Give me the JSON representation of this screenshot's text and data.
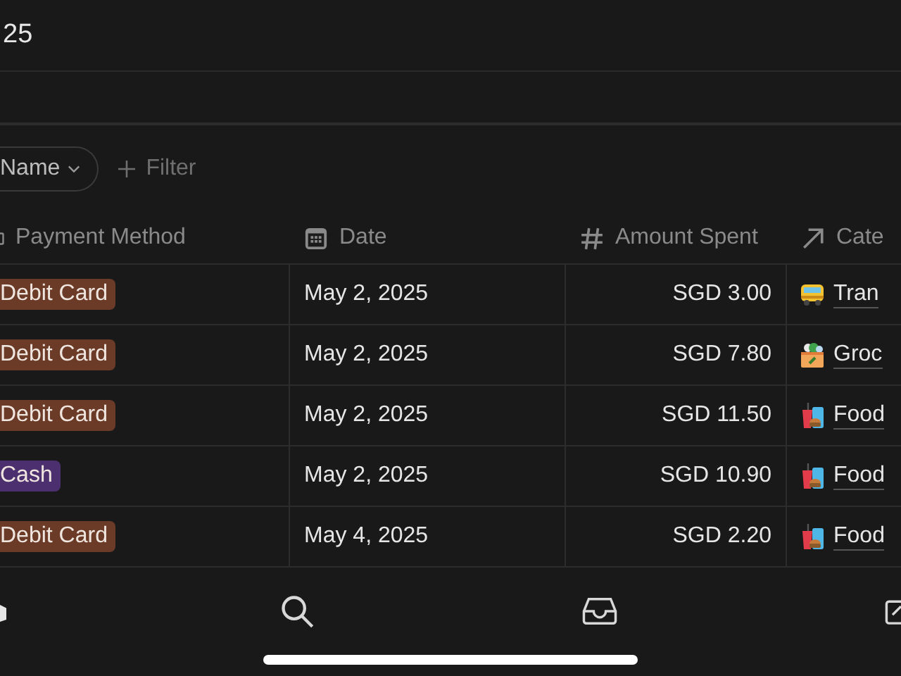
{
  "title": "25",
  "filter_bar": {
    "sort_chip": "Name",
    "filter_button": "Filter"
  },
  "table": {
    "columns": [
      "Payment Method",
      "Date",
      "Amount Spent",
      "Cate"
    ],
    "rows": [
      {
        "payment": "Debit Card",
        "color": "#6b3b27",
        "date": "May 2, 2025",
        "amount": "SGD 3.00",
        "category": "Tran",
        "kind": "bus"
      },
      {
        "payment": "Debit Card",
        "color": "#6b3b27",
        "date": "May 2, 2025",
        "amount": "SGD 7.80",
        "category": "Groc",
        "kind": "groceries"
      },
      {
        "payment": "Debit Card",
        "color": "#6b3b27",
        "date": "May 2, 2025",
        "amount": "SGD 11.50",
        "category": "Food",
        "kind": "food"
      },
      {
        "payment": "Cash",
        "color": "#4c2f6e",
        "date": "May 2, 2025",
        "amount": "SGD 10.90",
        "category": "Food",
        "kind": "food"
      },
      {
        "payment": "Debit Card",
        "color": "#6b3b27",
        "date": "May 4, 2025",
        "amount": "SGD 2.20",
        "category": "Food",
        "kind": "food"
      }
    ]
  },
  "tab_bar": [
    {
      "kind": "home"
    },
    {
      "kind": "search"
    },
    {
      "kind": "inbox"
    },
    {
      "kind": "compose"
    }
  ]
}
